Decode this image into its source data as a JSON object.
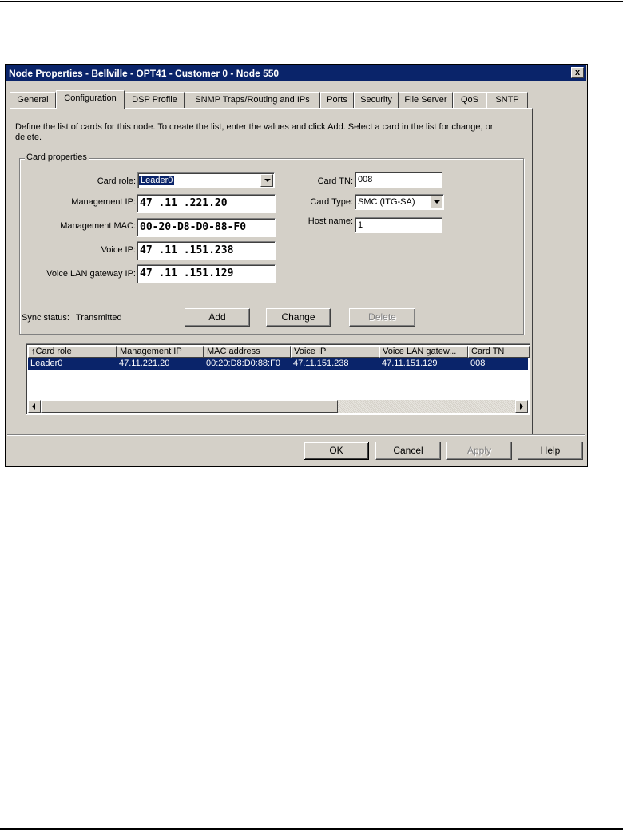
{
  "window": {
    "title": "Node Properties - Bellville - OPT41 - Customer 0 - Node 550",
    "close_label": "x"
  },
  "tabs": [
    "General",
    "Configuration",
    "DSP Profile",
    "SNMP Traps/Routing and IPs",
    "Ports",
    "Security",
    "File Server",
    "QoS",
    "SNTP"
  ],
  "active_tab": "Configuration",
  "description": "Define the list of cards for this node.  To create the list, enter the values and click Add.  Select a card in the list for change, or delete.",
  "card_properties": {
    "group_label": "Card properties",
    "card_role_label": "Card role:",
    "card_role_value": "Leader0",
    "management_ip_label": "Management IP:",
    "management_ip_value": "47 .11 .221.20",
    "management_mac_label": "Management MAC:",
    "management_mac_value": "00-20-D8-D0-88-F0",
    "voice_ip_label": "Voice IP:",
    "voice_ip_value": "47 .11 .151.238",
    "voice_gateway_label": "Voice LAN gateway IP:",
    "voice_gateway_value": "47 .11 .151.129",
    "card_tn_label": "Card TN:",
    "card_tn_value": "008",
    "card_type_label": "Card Type:",
    "card_type_value": "SMC (ITG-SA)",
    "host_name_label": "Host name:",
    "host_name_value": "1",
    "sync_status_label": "Sync status:",
    "sync_status_value": "Transmitted",
    "add_label": "Add",
    "change_label": "Change",
    "delete_label": "Delete"
  },
  "card_list": {
    "sort_arrow": "↑",
    "columns": [
      "Card role",
      "Management IP",
      "MAC address",
      "Voice IP",
      "Voice LAN gatew...",
      "Card TN"
    ],
    "rows": [
      [
        "Leader0",
        "47.11.221.20",
        "00:20:D8:D0:88:F0",
        "47.11.151.238",
        "47.11.151.129",
        "008"
      ]
    ]
  },
  "footer": {
    "ok_label": "OK",
    "cancel_label": "Cancel",
    "apply_label": "Apply",
    "help_label": "Help"
  }
}
